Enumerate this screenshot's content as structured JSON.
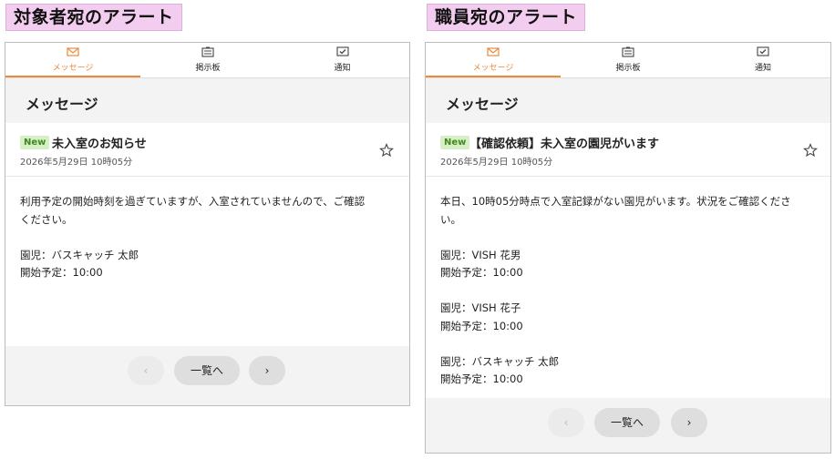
{
  "left": {
    "heading": "対象者宛のアラート",
    "tabs": [
      {
        "label": "メッセージ",
        "icon": "envelope-icon"
      },
      {
        "label": "掲示板",
        "icon": "bulletin-board-icon"
      },
      {
        "label": "通知",
        "icon": "notification-icon"
      }
    ],
    "page_title": "メッセージ",
    "badge": "New",
    "subject": "未入室のお知らせ",
    "date": "2026年5月29日 10時05分",
    "body": "利用予定の開始時刻を過ぎていますが、入室されていませんので、ご確認\nください。\n\n園児：バスキャッチ 太郎\n開始予定：10:00",
    "nav": {
      "prev": "‹",
      "list": "一覧へ",
      "next": "›"
    }
  },
  "right": {
    "heading": "職員宛のアラート",
    "tabs": [
      {
        "label": "メッセージ",
        "icon": "envelope-icon"
      },
      {
        "label": "掲示板",
        "icon": "bulletin-board-icon"
      },
      {
        "label": "通知",
        "icon": "notification-icon"
      }
    ],
    "page_title": "メッセージ",
    "badge": "New",
    "subject": "【確認依頼】未入室の園児がいます",
    "date": "2026年5月29日 10時05分",
    "body": "本日、10時05分時点で入室記録がない園児がいます。状況をご確認くださ\nい。\n\n園児：VISH 花男\n開始予定：10:00\n\n園児：VISH 花子\n開始予定：10:00\n\n園児：バスキャッチ 太郎\n開始予定：10:00",
    "nav": {
      "prev": "‹",
      "list": "一覧へ",
      "next": "›"
    }
  },
  "colors": {
    "accent": "#e98a3c",
    "badge_bg": "#d7efc6",
    "badge_text": "#3f8a1f",
    "heading_bg": "#f2cdef"
  }
}
